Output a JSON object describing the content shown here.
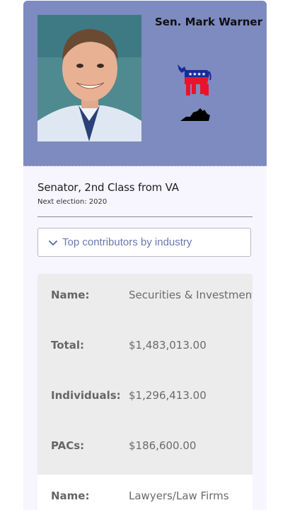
{
  "senator": {
    "name": "Sen. Mark Warner",
    "role": "Senator, 2nd Class from VA",
    "next_election": "Next election: 2020",
    "party_icon": "democrat-donkey-icon",
    "state_icon": "virginia-state-icon"
  },
  "accordion": {
    "label": "Top contributors by industry",
    "icon": "chevron-down-icon"
  },
  "contributors": [
    {
      "name_label": "Name:",
      "name": "Securities & Investment",
      "total_label": "Total:",
      "total": "$1,483,013.00",
      "individuals_label": "Individuals:",
      "individuals": "$1,296,413.00",
      "pacs_label": "PACs:",
      "pacs": "$186,600.00"
    },
    {
      "name_label": "Name:",
      "name": "Lawyers/Law Firms"
    }
  ],
  "colors": {
    "header_bg": "#7e8bc0",
    "card_bg": "#f7f5fd",
    "accent": "#6a77b2",
    "row_bg": "#ececec"
  }
}
